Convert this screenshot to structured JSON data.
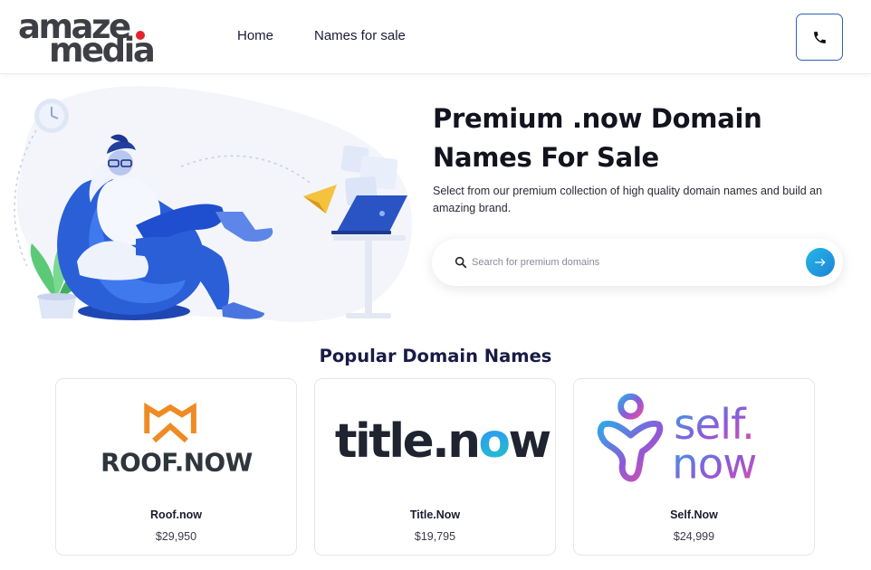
{
  "brand": {
    "logo_line1": "amaze",
    "logo_line2": "media"
  },
  "nav": {
    "items": [
      {
        "label": "Home"
      },
      {
        "label": "Names for sale"
      }
    ]
  },
  "hero": {
    "title": "Premium .now Domain Names For Sale",
    "subtitle": "Select from our premium collection of high quality domain names and build an amazing brand.",
    "search": {
      "placeholder": "Search for premium domains"
    }
  },
  "popular": {
    "title": "Popular Domain Names",
    "cards": [
      {
        "logo_text": "ROOF.NOW",
        "name": "Roof.now",
        "price": "$29,950"
      },
      {
        "logo_text_main": "title.n",
        "logo_text_o": "o",
        "logo_text_end": "w",
        "name": "Title.Now",
        "price": "$19,795"
      },
      {
        "logo_text_line1": "self.",
        "logo_text_line2": "now",
        "name": "Self.Now",
        "price": "$24,999"
      }
    ]
  },
  "colors": {
    "accent": "#2d61b3",
    "logo_dot": "#e4222e",
    "roof_orange": "#f08a24",
    "search_button": "#1c84d6",
    "heading": "#181b46"
  },
  "icons": {
    "phone": "phone-icon",
    "search": "search-icon",
    "submit": "arrow-right-icon"
  }
}
